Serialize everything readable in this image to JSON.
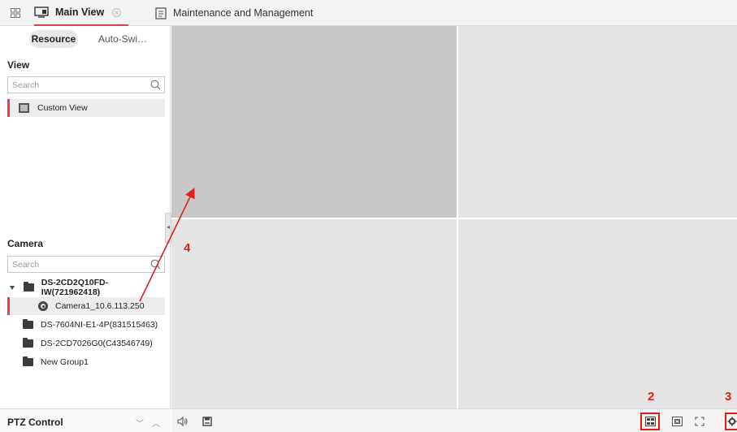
{
  "tabs": {
    "main_view": "Main View",
    "maintenance": "Maintenance and Management"
  },
  "left_panel": {
    "segment_resource": "Resource",
    "segment_autoswitch": "Auto-Swi…",
    "view_section": {
      "title": "View",
      "search_placeholder": "Search",
      "items": [
        {
          "label": "Custom View"
        }
      ]
    },
    "camera_section": {
      "title": "Camera",
      "search_placeholder": "Search",
      "tree": [
        {
          "label": "DS-2CD2Q10FD-IW(721962418)",
          "type": "group",
          "expanded": true
        },
        {
          "label": "Camera1_10.6.113.250",
          "type": "camera"
        },
        {
          "label": "DS-7604NI-E1-4P(831515463)",
          "type": "group"
        },
        {
          "label": "DS-2CD7026G0(C43546749)",
          "type": "group"
        },
        {
          "label": "New Group1",
          "type": "group"
        }
      ]
    },
    "ptz_label": "PTZ Control"
  },
  "annotations": {
    "marker_2": "2",
    "marker_3": "3",
    "marker_4": "4"
  },
  "icons": {
    "top_left": "app-grid-icon",
    "main_view_tab": "monitor-icon",
    "maintenance_tab": "clipboard-icon",
    "toolbar": [
      "speaker-icon",
      "save-icon",
      "window-layout-icon",
      "close-all-icon",
      "fullscreen-icon",
      "settings-icon"
    ]
  },
  "colors": {
    "accent": "#e0424b",
    "annotation": "#e02020",
    "selected_cell": "#c8c8c8",
    "empty_cell": "#e4e4e4"
  }
}
